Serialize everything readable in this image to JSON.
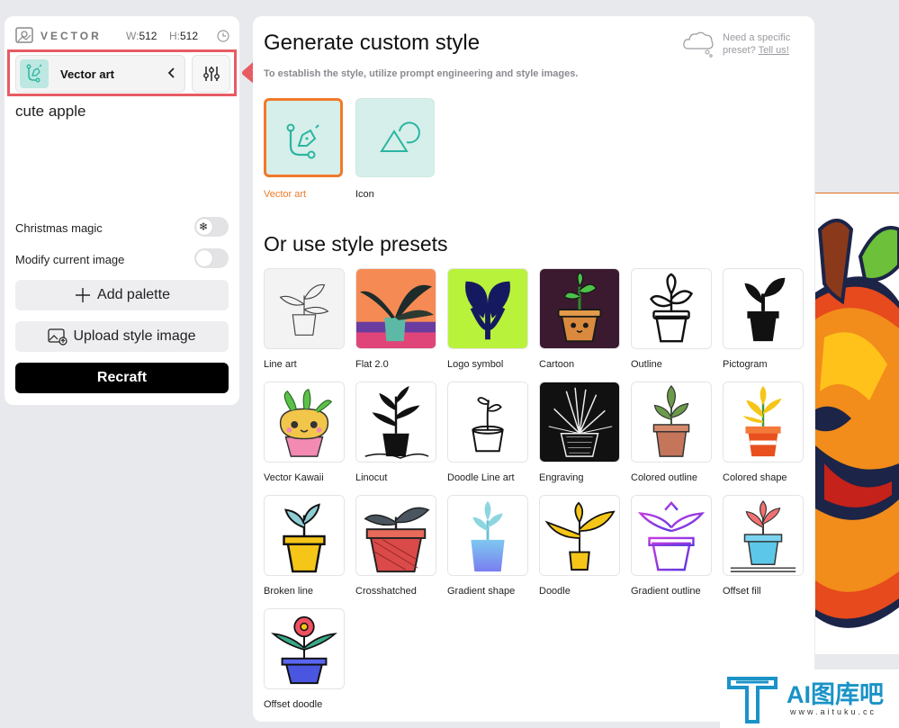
{
  "left_panel": {
    "brand": "VECTOR",
    "width_label": "W:",
    "width_value": "512",
    "height_label": "H:",
    "height_value": "512",
    "style_name": "Vector art",
    "prompt": "cute apple",
    "toggles": [
      {
        "label": "Christmas magic",
        "on": true
      },
      {
        "label": "Modify current image",
        "on": false
      }
    ],
    "add_palette": "Add palette",
    "upload_style": "Upload style image",
    "recraft": "Recraft"
  },
  "main": {
    "title": "Generate custom style",
    "subtitle": "To establish the style, utilize prompt engineering and style images.",
    "help_line1": "Need a specific",
    "help_line2": "preset?",
    "help_link": "Tell us!",
    "custom_styles": [
      {
        "label": "Vector art",
        "selected": true
      },
      {
        "label": "Icon",
        "selected": false
      }
    ],
    "presets_title": "Or use style presets",
    "presets": [
      {
        "label": "Line art"
      },
      {
        "label": "Flat 2.0"
      },
      {
        "label": "Logo symbol"
      },
      {
        "label": "Cartoon"
      },
      {
        "label": "Outline"
      },
      {
        "label": "Pictogram"
      },
      {
        "label": "Vector Kawaii"
      },
      {
        "label": "Linocut"
      },
      {
        "label": "Doodle Line art"
      },
      {
        "label": "Engraving"
      },
      {
        "label": "Colored outline"
      },
      {
        "label": "Colored shape"
      },
      {
        "label": "Broken line"
      },
      {
        "label": "Crosshatched"
      },
      {
        "label": "Gradient shape"
      },
      {
        "label": "Doodle"
      },
      {
        "label": "Gradient outline"
      },
      {
        "label": "Offset fill"
      },
      {
        "label": "Offset doodle"
      }
    ]
  },
  "watermark": {
    "text": "AI图库吧",
    "url": "www.aituku.cc"
  },
  "colors": {
    "accent_selected": "#f07a28",
    "highlight": "#e85b63",
    "teal_card": "#d6efeb",
    "teal_icon": "#2bb5a0"
  }
}
